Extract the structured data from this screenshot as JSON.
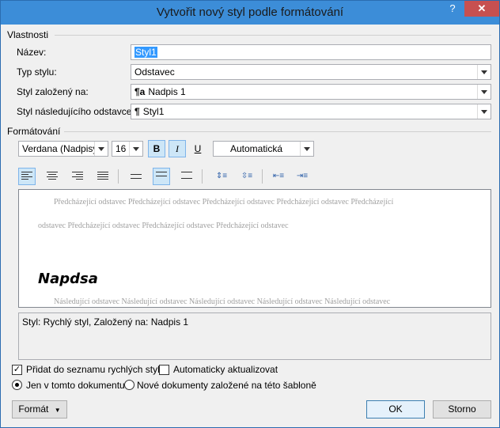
{
  "window": {
    "title": "Vytvořit nový styl podle formátování",
    "help_glyph": "?",
    "close_glyph": "✕"
  },
  "properties": {
    "group_label": "Vlastnosti",
    "name_label": "Název:",
    "name_value": "Styl1",
    "type_label": "Typ stylu:",
    "type_value": "Odstavec",
    "based_label": "Styl založený na:",
    "based_value": "Nadpis 1",
    "based_icon": "¶a",
    "next_label": "Styl následujícího odstavce:",
    "next_value": "Styl1",
    "next_icon": "¶"
  },
  "formatting": {
    "group_label": "Formátování",
    "font": "Verdana (Nadpisy)",
    "size": "16",
    "bold": "B",
    "italic": "I",
    "underline": "U",
    "color": "Automatická"
  },
  "preview": {
    "prev_line1": "Předcházející odstavec Předcházející odstavec Předcházející odstavec Předcházející odstavec Předcházející",
    "prev_line2": "odstavec Předcházející odstavec Předcházející odstavec Předcházející odstavec",
    "heading": "Napdsa",
    "next_line1": "Následující odstavec Následující odstavec Následující odstavec Následující odstavec Následující odstavec"
  },
  "description": "Styl: Rychlý styl, Založený na: Nadpis 1",
  "options": {
    "add_quick_label": "Přidat do seznamu rychlých stylů",
    "add_quick_checked": true,
    "auto_update_label": "Automaticky aktualizovat",
    "auto_update_checked": false,
    "only_doc_label": "Jen v tomto dokumentu",
    "new_docs_label": "Nové dokumenty založené na této šabloně"
  },
  "buttons": {
    "format": "Formát",
    "ok": "OK",
    "cancel": "Storno"
  }
}
